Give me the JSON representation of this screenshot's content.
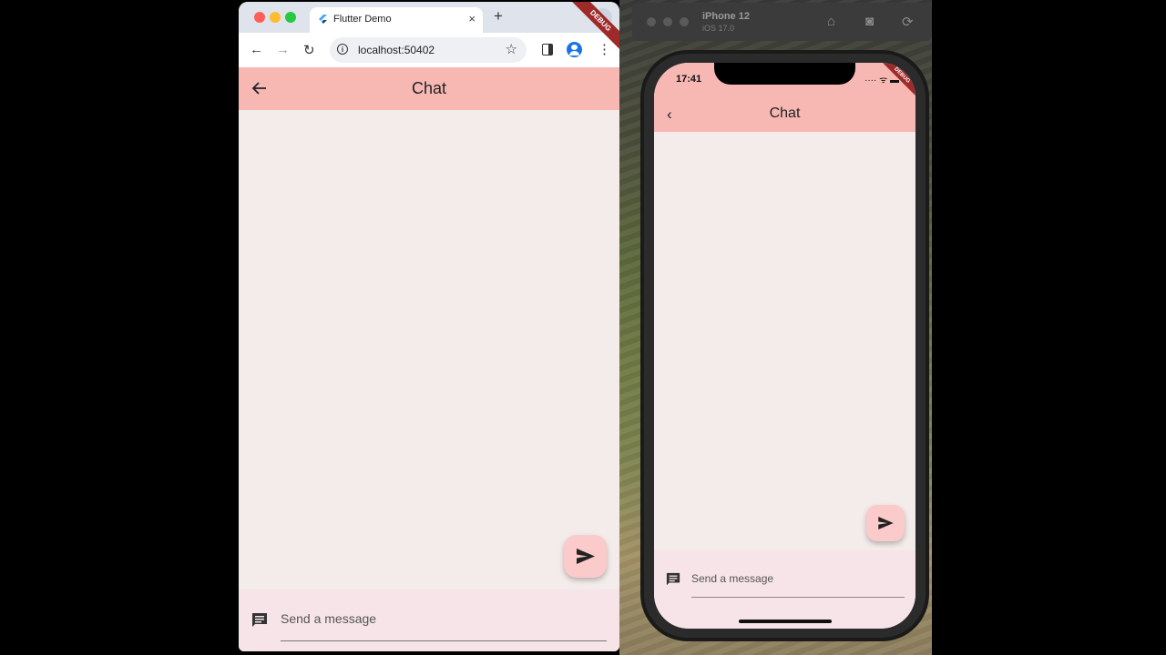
{
  "browser": {
    "tab_title": "Flutter Demo",
    "tab_close": "×",
    "new_tab": "+",
    "tab_menu": "⌄",
    "url": "localhost:50402",
    "back": "←",
    "forward": "→",
    "reload": "↻",
    "star": "☆",
    "menu": "⋮"
  },
  "web_app": {
    "title": "Chat",
    "debug_banner": "DEBUG",
    "message_placeholder": "Send a message"
  },
  "simulator": {
    "device_name": "iPhone 12",
    "os_version": "iOS 17.0",
    "home_icon": "⌂",
    "screenshot_icon": "◙",
    "rotate_icon": "⟳"
  },
  "phone_app": {
    "time": "17:41",
    "status_icons": "···· ᯤ ▬",
    "title": "Chat",
    "back": "‹",
    "debug_banner": "DEBUG",
    "message_placeholder": "Send a message"
  },
  "colors": {
    "app_bar": "#f7b8b4",
    "background": "#f4ecea",
    "fab": "#fbcaca",
    "composer": "#f6e4e9",
    "debug_banner": "#9e2a2a"
  }
}
